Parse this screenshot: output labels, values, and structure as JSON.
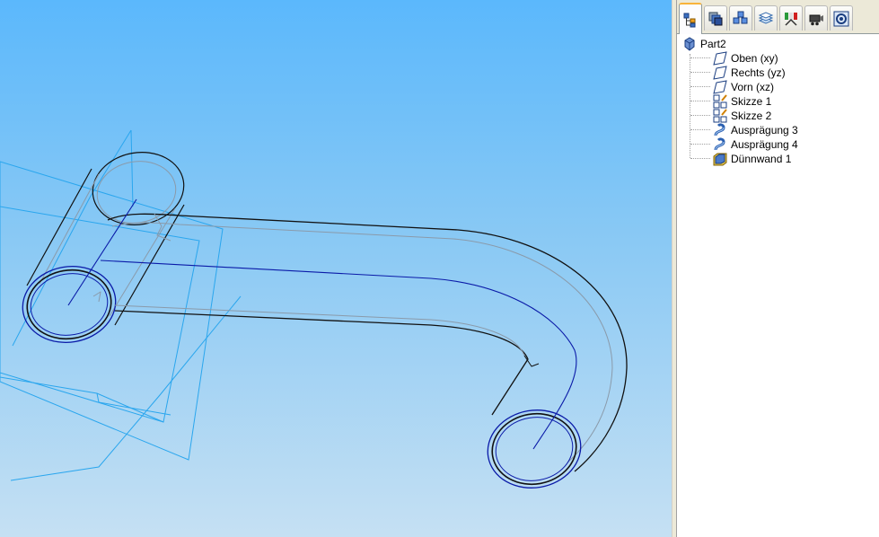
{
  "tabs": [
    {
      "icon": "feature-tree-icon",
      "active": true
    },
    {
      "icon": "layers-icon",
      "active": false
    },
    {
      "icon": "assembly-icon",
      "active": false
    },
    {
      "icon": "sheets-icon",
      "active": false
    },
    {
      "icon": "material-icon",
      "active": false
    },
    {
      "icon": "camera-icon",
      "active": false
    },
    {
      "icon": "settings-icon",
      "active": false
    }
  ],
  "tree": {
    "root": {
      "label": "Part2",
      "icon": "part-icon"
    },
    "items": [
      {
        "label": "Oben (xy)",
        "icon": "plane-icon"
      },
      {
        "label": "Rechts (yz)",
        "icon": "plane-icon"
      },
      {
        "label": "Vorn (xz)",
        "icon": "plane-icon"
      },
      {
        "label": "Skizze 1",
        "icon": "sketch-icon"
      },
      {
        "label": "Skizze 2",
        "icon": "sketch-icon"
      },
      {
        "label": "Ausprägung 3",
        "icon": "sweep-icon"
      },
      {
        "label": "Ausprägung 4",
        "icon": "sweep-icon"
      },
      {
        "label": "Dünnwand 1",
        "icon": "shell-icon"
      }
    ]
  },
  "colors": {
    "viewport_top": "#5bb8fc",
    "viewport_bottom": "#c5e0f3",
    "plane_lines": "#2aa6ee",
    "edge_dark": "#101010",
    "edge_blue": "#0a1aa8",
    "active_tab_accent": "#f8b33a"
  }
}
